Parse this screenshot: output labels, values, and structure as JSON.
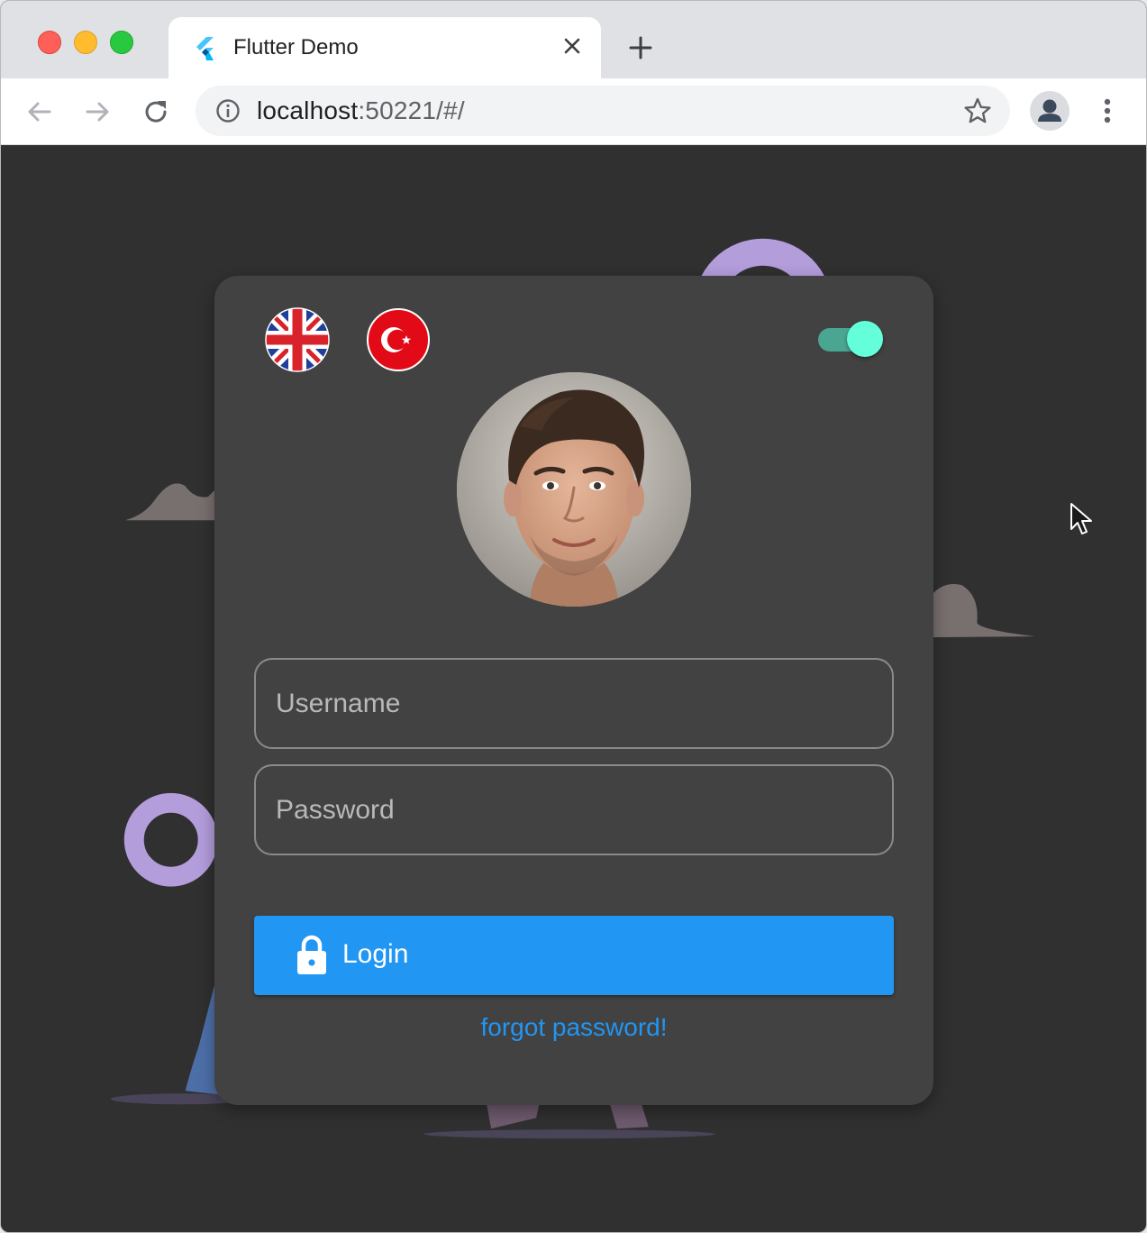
{
  "browser": {
    "tab": {
      "title": "Flutter Demo"
    },
    "address": {
      "host": "localhost",
      "rest": ":50221/#/"
    }
  },
  "login": {
    "username_placeholder": "Username",
    "password_placeholder": "Password",
    "login_label": "Login",
    "forgot_label": "forgot password!",
    "theme_toggle_on": true
  },
  "colors": {
    "page_background": "#303030",
    "card_background": "#424242",
    "primary": "#2196f3",
    "toggle_accent": "#64ffda",
    "decor_purple": "#b39ddb"
  }
}
